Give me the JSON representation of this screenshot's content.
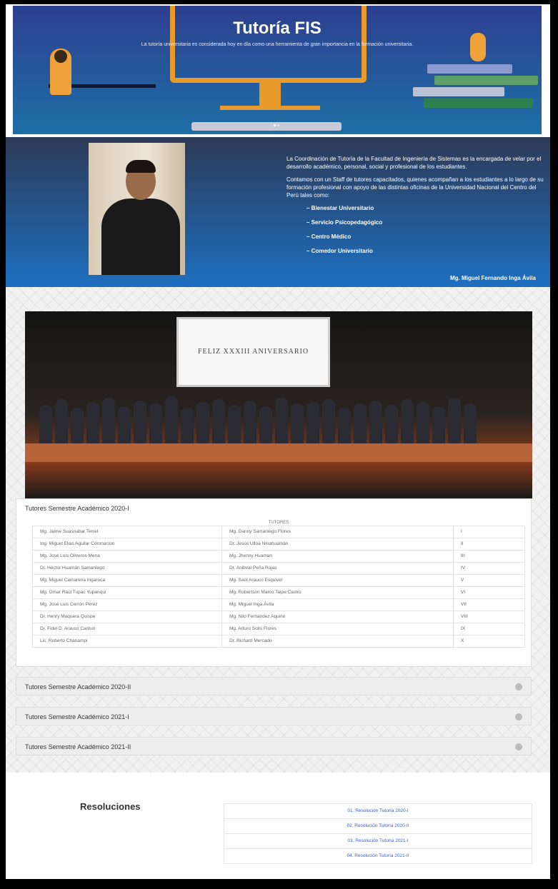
{
  "hero": {
    "title": "Tutoría FIS",
    "subtitle": "La tutoría universitaria es considerada hoy en día como una herramienta de gran importancia en la formación universitaria."
  },
  "coordinator": {
    "paragraph1": "La Coordinación de Tutoría de la Facultad de Ingeniería de Sistemas es la encargada de velar por el desarrollo académico, personal, social y profesional de los estudiantes.",
    "paragraph2": "Contamos con un Staff de tutores capacitados, quienes acompañan a los estudiantes a lo largo de su formación profesional con apoyo de las distintas oficinas de la Universidad Nacional del Centro del Perú tales como:",
    "services": [
      "– Bienestar Universitario",
      "– Servicio Psicopedagógico",
      "– Centro Médico",
      "– Comedor Universitario"
    ],
    "signature": "Mg. Miguel Fernando Inga Ávila"
  },
  "event_photo": {
    "screen_text": "FELIZ XXXIII ANIVERSARIO"
  },
  "tutors_2020_1": {
    "title": "Tutores Semestre Académico 2020-I",
    "header": "TUTORES",
    "rows": [
      [
        "Mg. Jaime Suasnabar Terrel",
        "Mg. Danny Samaniego Flores",
        "I"
      ],
      [
        "Ing. Miguel Elias Aguilar Coronacion",
        "Dr. Jesús Ulloa Ninahuamán",
        "II"
      ],
      [
        "Mg. José Luis Oliveros Mena",
        "Mg. Jhenny Huaman",
        "III"
      ],
      [
        "Dr. Héctor Huamán Samaniego",
        "Dr. Anibval Peña Rojas",
        "IV"
      ],
      [
        "Mg. Miguel Camarena Ingaruca",
        "Mg. Saúl Arauco Esquivel",
        "V"
      ],
      [
        "Mg. Omar Raúl Tupac Yupanqui",
        "Mg. Robertson Marco Taipe Castro",
        "VI"
      ],
      [
        "Mg. José Luis Cerrón Pérez",
        "Mg. Miguel Inga Ávila",
        "VII"
      ],
      [
        "Dr. Henry Maquera Quispe",
        "Mg. Nilo Fernandez Aquino",
        "VIII"
      ],
      [
        "Dr. Fidel D. Arauco Canturi",
        "Mg. Arturo Solís Flores",
        "IX"
      ],
      [
        "Lic. Roberto Chanampi",
        "Dr. Richard Mercado",
        "X"
      ]
    ]
  },
  "accordion": [
    "Tutores Semestre Académico 2020-II",
    "Tutores Semestre Académico 2021-I",
    "Tutores Semestre Académico 2021-II"
  ],
  "resoluciones": {
    "title": "Resoluciones",
    "links": [
      "01. Resolución Tutoría 2020-I",
      "02. Resolución Tutoría 2020-II",
      "03. Resolución Tutoría 2021-I",
      "04. Resolución Tutoría 2021-II"
    ]
  }
}
